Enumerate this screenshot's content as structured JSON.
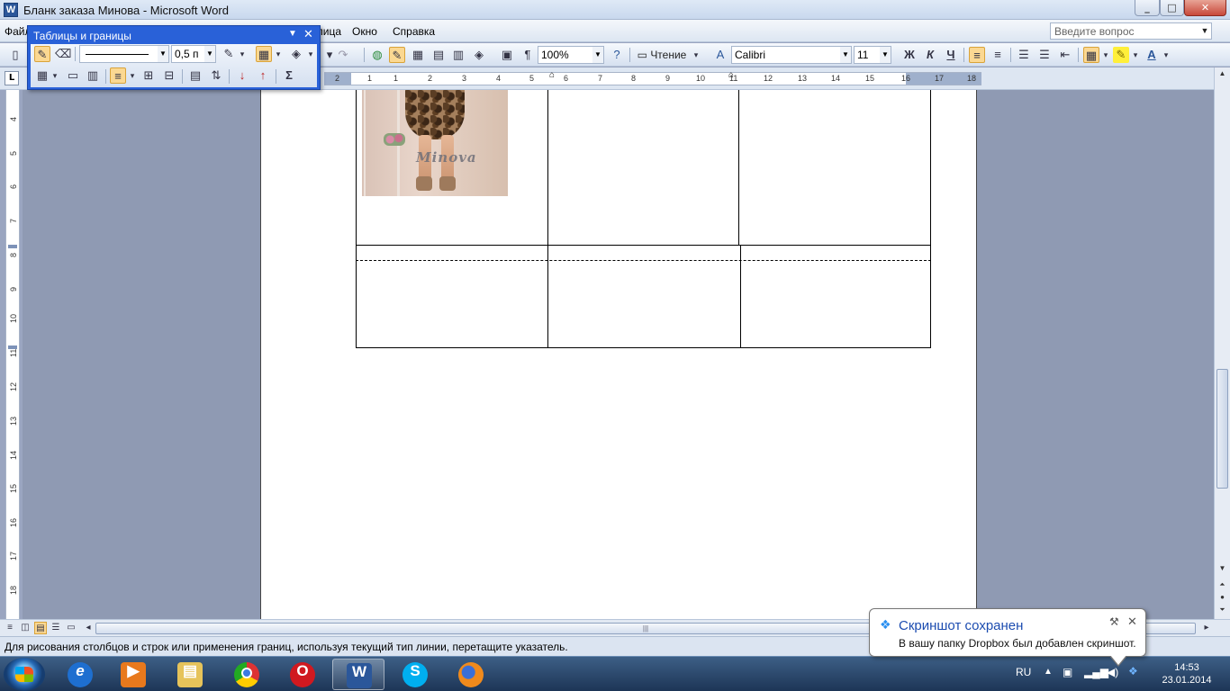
{
  "window": {
    "title": "Бланк заказа Минова - Microsoft Word",
    "app_icon": "word-icon",
    "minimize": "_",
    "maximize": "□",
    "close": "✕"
  },
  "menu": {
    "items": [
      "Файл",
      "Таблица",
      "Окно",
      "Справка"
    ],
    "help_placeholder": "Введите вопрос"
  },
  "toolbar": {
    "zoom": "100%",
    "reading_label": "Чтение",
    "font_name": "Calibri",
    "font_size": "11",
    "bold": "Ж",
    "italic": "К",
    "underline": "Ч",
    "pilcrow": "¶",
    "sigma": "Σ"
  },
  "tables_toolbar": {
    "title": "Таблицы и границы",
    "line_weight": "0,5 п"
  },
  "ruler": {
    "numbers": [
      "2",
      "1",
      "1",
      "2",
      "3",
      "4",
      "5",
      "6",
      "7",
      "8",
      "9",
      "10",
      "11",
      "12",
      "13",
      "14",
      "15",
      "16",
      "17",
      "18"
    ],
    "vertical_numbers": [
      "4",
      "5",
      "6",
      "7",
      "8",
      "9",
      "10",
      "11",
      "12",
      "13",
      "14",
      "15",
      "16",
      "17",
      "18"
    ],
    "tab_selector": "L"
  },
  "document": {
    "photo_watermark": "Minova"
  },
  "status": {
    "text": "Для рисования столбцов и строк или применения границ, используя текущий тип линии, перетащите указатель."
  },
  "notification": {
    "title": "Скриншот сохранен",
    "text": "В вашу папку Dropbox был добавлен скриншот."
  },
  "taskbar": {
    "apps": [
      "internet-explorer",
      "media-player",
      "file-explorer",
      "chrome",
      "opera",
      "word",
      "skype",
      "firefox"
    ],
    "language": "RU",
    "time": "14:53",
    "date": "23.01.2014",
    "word_label": "W",
    "opera_label": "O"
  },
  "colors": {
    "accent_toolbar": "#2961d8",
    "active_button": "#fbd892",
    "notification_title": "#1c4cb0"
  }
}
